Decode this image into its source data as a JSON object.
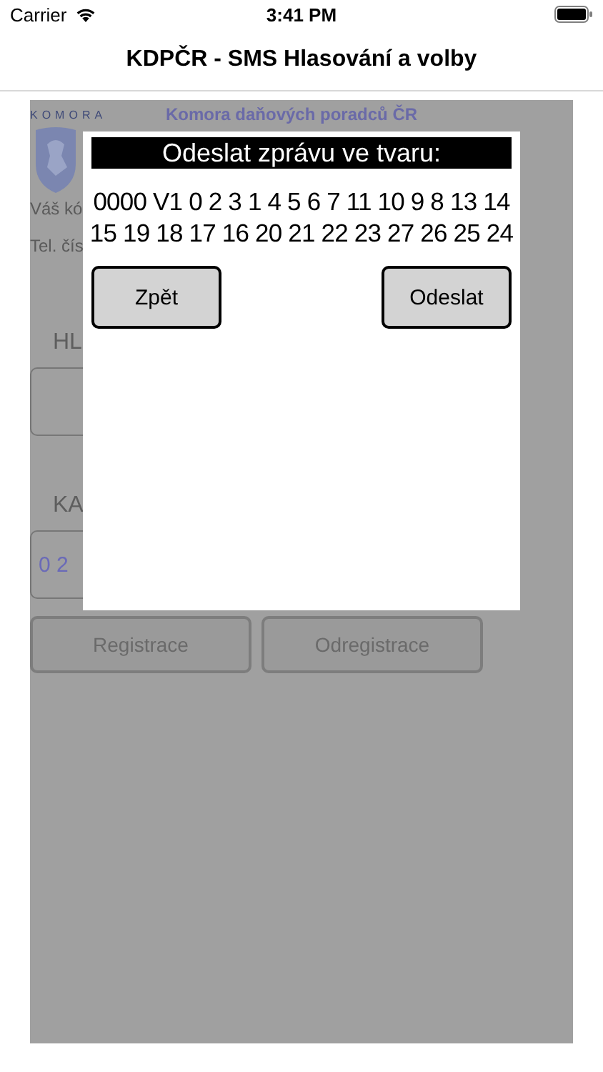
{
  "status_bar": {
    "carrier": "Carrier",
    "time": "3:41 PM"
  },
  "nav": {
    "title": "KDPČR - SMS Hlasování a volby"
  },
  "background": {
    "logo_text": "KOMORA",
    "header": "Komora daňových poradců ČR",
    "code_label": "Váš kó",
    "phone_label": "Tel. čís",
    "vote_label": "HL",
    "candidates_label": "KA",
    "candidates_value": "0 2",
    "buttons": [
      "Registrace",
      "Odregistrace"
    ]
  },
  "dialog": {
    "title": "Odeslat zprávu ve tvaru:",
    "message": "0000 V1 0 2 3 1 4 5 6 7 11 10 9 8 13 14 15 19 18 17 16 20 21 22 23 27 26 25 24",
    "buttons": [
      "Zpět",
      "Odeslat"
    ]
  }
}
